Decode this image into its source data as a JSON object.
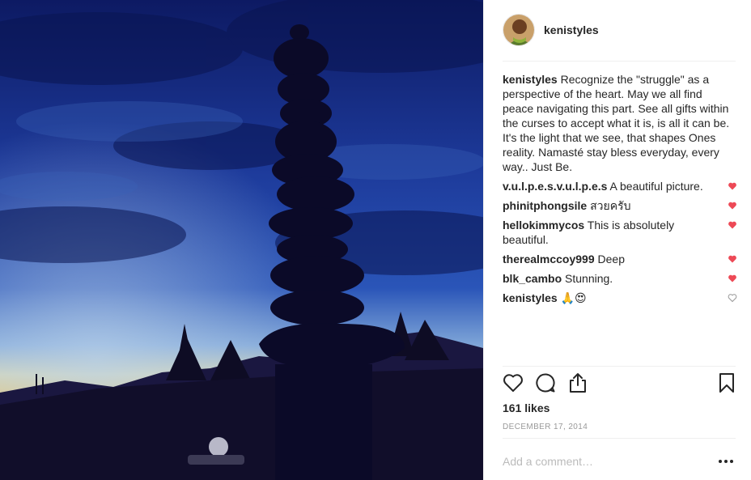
{
  "header": {
    "username": "kenistyles",
    "avatar_icon": "profile-avatar"
  },
  "caption": {
    "username": "kenistyles",
    "text": "Recognize the \"struggle\" as a perspective of the heart. May we all find peace navigating this part. See all gifts within the curses to accept what it is, is all it can be. It's the light that we see, that shapes Ones reality. Namasté stay bless everyday, every way.. Just Be."
  },
  "comments": [
    {
      "username": "v.u.l.p.e.s.v.u.l.p.e.s",
      "text": "A beautiful picture.",
      "liked": true
    },
    {
      "username": "phinitphongsile",
      "text": "สวยครับ",
      "liked": true
    },
    {
      "username": "hellokimmycos",
      "text": "This is absolutely beautiful.",
      "liked": true
    },
    {
      "username": "therealmccoy999",
      "text": "Deep",
      "liked": true
    },
    {
      "username": "blk_cambo",
      "text": "Stunning.",
      "liked": true
    },
    {
      "username": "kenistyles",
      "text": "🙏😍",
      "liked": false
    }
  ],
  "actions": {
    "like_icon": "heart-outline-icon",
    "comment_icon": "comment-bubble-icon",
    "share_icon": "share-icon",
    "save_icon": "bookmark-icon"
  },
  "likes": "161 likes",
  "date": "DECEMBER 17, 2014",
  "comment_box": {
    "placeholder": "Add a comment…",
    "more_icon": "more-options-icon"
  },
  "colors": {
    "liked_heart": "#ed4956",
    "unliked_heart": "#999999",
    "text": "#262626",
    "muted": "#999999"
  }
}
